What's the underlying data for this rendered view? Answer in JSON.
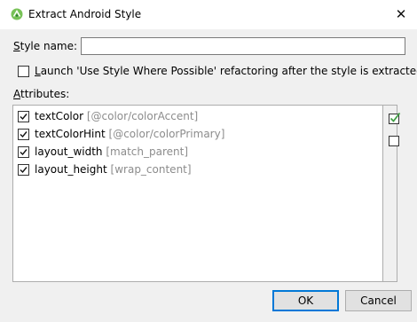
{
  "window": {
    "title": "Extract Android Style",
    "close_glyph": "✕",
    "icon": "android-studio-icon"
  },
  "style_name": {
    "label_mnemonic": "S",
    "label_rest": "tyle name:",
    "value": ""
  },
  "refactor_option": {
    "mnemonic": "L",
    "rest": "aunch 'Use Style Where Possible' refactoring after the style is extracted",
    "checked": false
  },
  "attributes": {
    "label_mnemonic": "A",
    "label_rest": "ttributes:",
    "items": [
      {
        "name": "textColor",
        "value": "[@color/colorAccent]",
        "checked": true
      },
      {
        "name": "textColorHint",
        "value": "[@color/colorPrimary]",
        "checked": true
      },
      {
        "name": "layout_width",
        "value": "[match_parent]",
        "checked": true
      },
      {
        "name": "layout_height",
        "value": "[wrap_content]",
        "checked": true
      }
    ]
  },
  "side_buttons": {
    "select_all_icon": "select-all-icon",
    "unselect_all_icon": "unselect-all-icon",
    "accent_color": "#43a047"
  },
  "buttons": {
    "ok_label": "OK",
    "cancel_label": "Cancel"
  },
  "colors": {
    "default_button_border": "#0078d7",
    "value_text": "#8c8c8c"
  }
}
